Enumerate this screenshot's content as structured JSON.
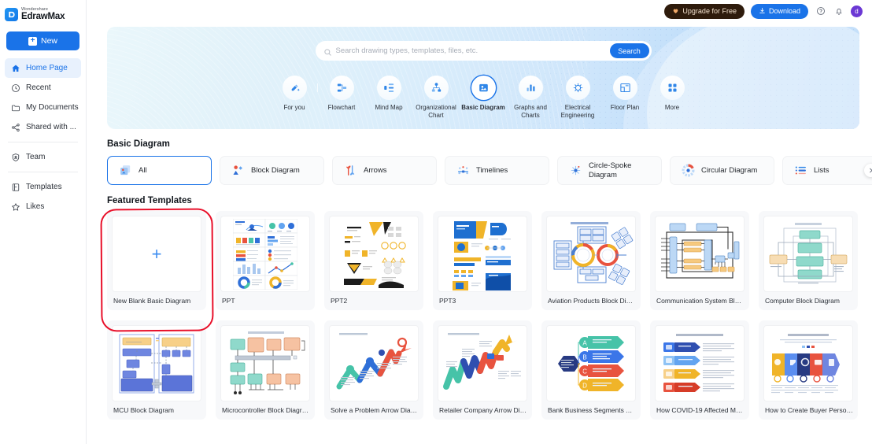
{
  "brand": {
    "small": "Wondershare",
    "name": "EdrawMax",
    "logo_icon": "edraw-logo-icon",
    "accent": "#1a73e8"
  },
  "sidebar": {
    "new_label": "New",
    "items": [
      {
        "label": "Home Page",
        "icon": "home-icon",
        "active": true
      },
      {
        "label": "Recent",
        "icon": "clock-icon",
        "active": false
      },
      {
        "label": "My Documents",
        "icon": "folder-icon",
        "active": false
      },
      {
        "label": "Shared with ...",
        "icon": "share-nodes-icon",
        "active": false
      },
      {
        "label": "Team",
        "icon": "team-shield-icon",
        "active": false
      },
      {
        "label": "Templates",
        "icon": "templates-icon",
        "active": false
      },
      {
        "label": "Likes",
        "icon": "star-icon",
        "active": false
      }
    ]
  },
  "header": {
    "upgrade_label": "Upgrade for Free",
    "upgrade_icon": "gem-icon",
    "upgrade_bg": "#2e1b0c",
    "download_label": "Download",
    "download_icon": "download-icon",
    "help_icon": "help-circle-icon",
    "bell_icon": "bell-icon",
    "avatar_initial": "d",
    "avatar_bg": "#6b38d4"
  },
  "search": {
    "placeholder": "Search drawing types, templates, files, etc.",
    "value": "",
    "button_label": "Search",
    "icon": "search-icon"
  },
  "categories": [
    {
      "label": "For you",
      "icon": "sparkle-pen-icon",
      "selected": false
    },
    {
      "label": "Flowchart",
      "icon": "flowchart-icon",
      "selected": false
    },
    {
      "label": "Mind Map",
      "icon": "mindmap-icon",
      "selected": false
    },
    {
      "label": "Organizational Chart",
      "icon": "org-chart-icon",
      "selected": false
    },
    {
      "label": "Basic Diagram",
      "icon": "basic-diagram-icon",
      "selected": true
    },
    {
      "label": "Graphs and Charts",
      "icon": "bar-chart-icon",
      "selected": false
    },
    {
      "label": "Electrical Engineering",
      "icon": "electrical-icon",
      "selected": false
    },
    {
      "label": "Floor Plan",
      "icon": "floor-plan-icon",
      "selected": false
    },
    {
      "label": "More",
      "icon": "grid-more-icon",
      "selected": false
    }
  ],
  "section": {
    "title": "Basic Diagram",
    "featured_title": "Featured Templates",
    "next_icon": "chevron-right-icon"
  },
  "chips": [
    {
      "label": "All",
      "icon": "all-shapes-icon",
      "active": true
    },
    {
      "label": "Block Diagram",
      "icon": "block-diagram-icon",
      "active": false
    },
    {
      "label": "Arrows",
      "icon": "arrows-icon",
      "active": false
    },
    {
      "label": "Timelines",
      "icon": "timelines-icon",
      "active": false
    },
    {
      "label": "Circle-Spoke Diagram",
      "icon": "circle-spoke-icon",
      "active": false
    },
    {
      "label": "Circular Diagram",
      "icon": "circular-diagram-icon",
      "active": false
    },
    {
      "label": "Lists",
      "icon": "lists-icon",
      "active": false
    },
    {
      "label": "",
      "icon": "partial-chip-icon",
      "active": false
    }
  ],
  "templates_row1": [
    {
      "title": "New Blank Basic Diagram",
      "thumb": "blank-plus"
    },
    {
      "title": "PPT",
      "thumb": "ppt-grid"
    },
    {
      "title": "PPT2",
      "thumb": "ppt-yellow"
    },
    {
      "title": "PPT3",
      "thumb": "ppt-blue"
    },
    {
      "title": "Aviation Products Block Diag...",
      "thumb": "aviation-block"
    },
    {
      "title": "Communication System Bloc...",
      "thumb": "communication-block"
    },
    {
      "title": "Computer Block Diagram",
      "thumb": "computer-block"
    }
  ],
  "templates_row2": [
    {
      "title": "MCU Block Diagram",
      "thumb": "mcu-block"
    },
    {
      "title": "Microcontroller Block Diagram",
      "thumb": "microcontroller-block"
    },
    {
      "title": "Solve a Problem Arrow Diagr...",
      "thumb": "zigzag-arrow"
    },
    {
      "title": "Retailer Company Arrow Diag...",
      "thumb": "retailer-arrow"
    },
    {
      "title": "Bank Business Segments Arro...",
      "thumb": "bank-segments"
    },
    {
      "title": "How COVID-19 Affected Meg...",
      "thumb": "covid-arrows"
    },
    {
      "title": "How to Create Buyer Personas",
      "thumb": "buyer-personas"
    }
  ],
  "annotation": {
    "shape": "red-rounded-rectangle",
    "color": "#e8102a"
  }
}
